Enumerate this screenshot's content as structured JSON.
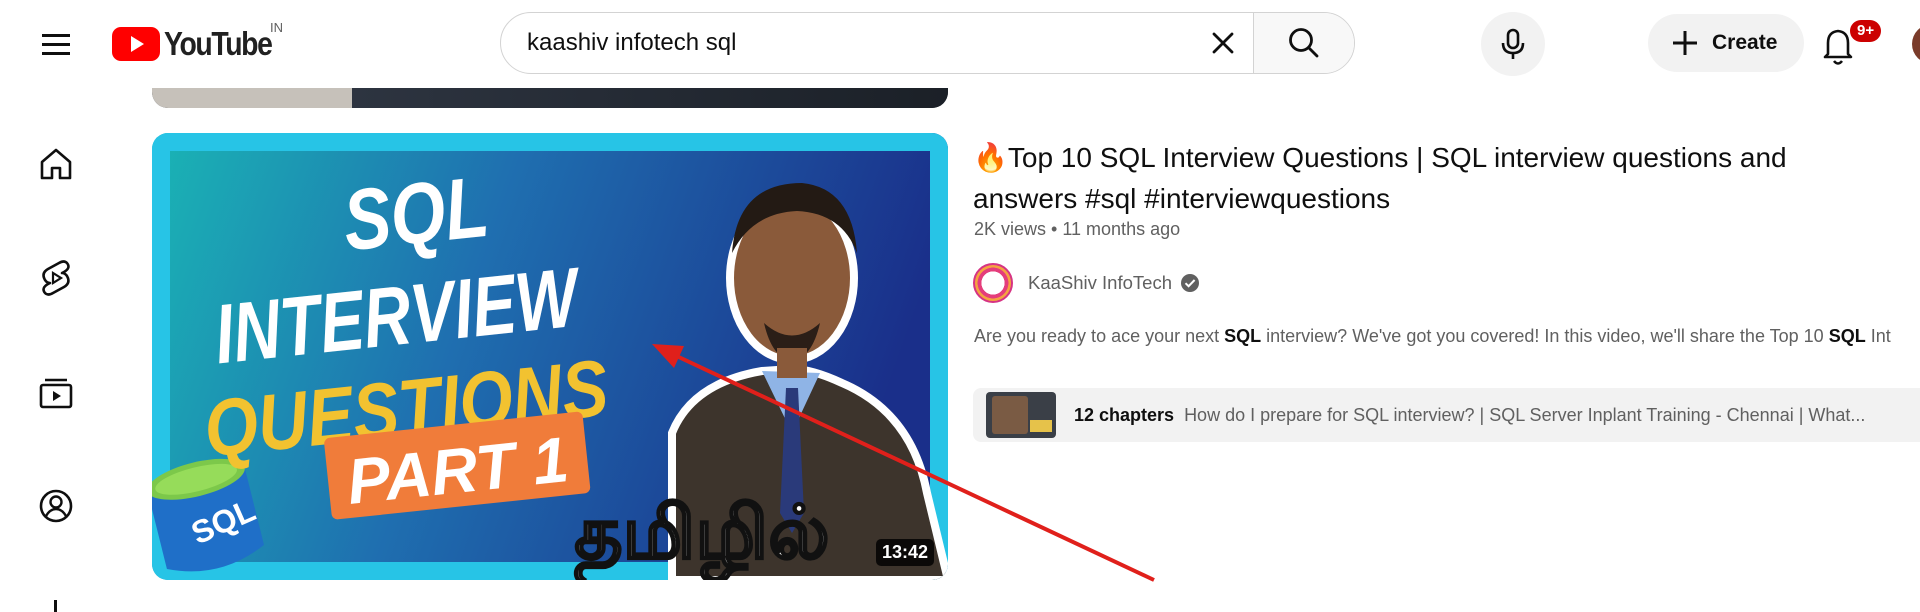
{
  "header": {
    "logo_text": "YouTube",
    "country_code": "IN",
    "search": {
      "value": "kaashiv infotech sql",
      "placeholder": "Search"
    },
    "create_label": "Create",
    "notification_badge": "9+"
  },
  "video": {
    "title_emoji": "🔥",
    "title": "Top 10 SQL Interview Questions | SQL interview questions and answers #sql #interviewquestions",
    "views": "2K views",
    "age": "11 months ago",
    "channel": "KaaShiv InfoTech",
    "verified": true,
    "description_parts": [
      "Are you ready to ace your next ",
      "SQL",
      " interview? We've got you covered! In this video, we'll share the Top 10 ",
      "SQL",
      " Int"
    ],
    "duration": "13:42",
    "thumbnail_text": {
      "line1": "SQL",
      "line2": "INTERVIEW",
      "line3": "QUESTIONS",
      "line4": "PART 1",
      "bucket_label": "SQL",
      "tamil": "தமிழில்"
    },
    "chapters": {
      "count_label": "12 chapters",
      "text": "How do I prepare for SQL interview? | SQL Server Inplant Training - Chennai | What..."
    }
  },
  "colors": {
    "youtube_red": "#ff0000",
    "annotation_arrow": "#e0201b",
    "badge_red": "#cc0000",
    "text_secondary": "#606060",
    "thumb_gold": "#f2c230",
    "thumb_orange": "#f07c3a"
  },
  "icons": [
    "hamburger-icon",
    "youtube-logo-icon",
    "clear-icon",
    "search-icon",
    "mic-icon",
    "plus-icon",
    "bell-icon",
    "home-icon",
    "shorts-icon",
    "subscriptions-icon",
    "you-icon",
    "verified-icon"
  ]
}
